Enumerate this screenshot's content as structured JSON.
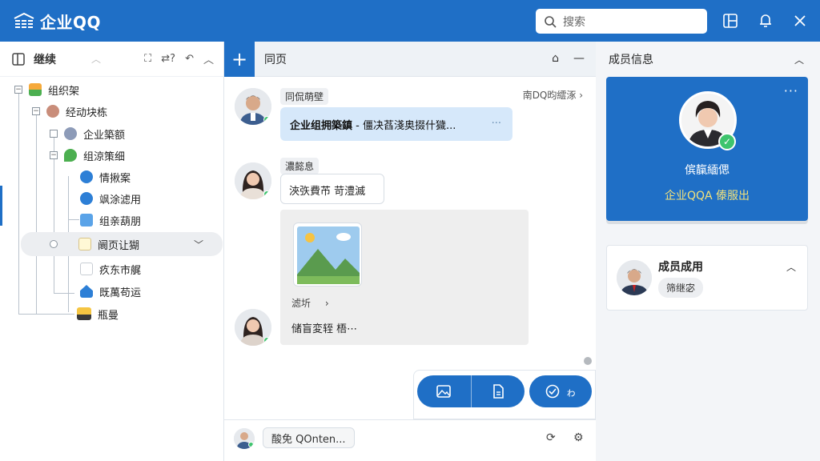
{
  "app": {
    "title": "企业QQ"
  },
  "search": {
    "placeholder": "搜索"
  },
  "left": {
    "title": "继续",
    "tree": [
      {
        "label": "组织架"
      },
      {
        "label": "经动块栋"
      },
      {
        "label": "企业築额"
      },
      {
        "label": "组涼策细"
      },
      {
        "label": "情揪案"
      },
      {
        "label": "飒涂滤用"
      },
      {
        "label": "组亲葫朋"
      },
      {
        "label": "阛页让猢"
      },
      {
        "label": "疚东市艉"
      },
      {
        "label": "既萬苟运"
      },
      {
        "label": "瓶曼"
      }
    ]
  },
  "mid": {
    "tab": "同页",
    "top_link": "南DQ昀繧涿",
    "messages": {
      "m1_name": "同侃萌壁",
      "m1_strong": "企业组拥築鎮",
      "m1_text": " - 僵决萏淺奥掇什獩...",
      "m1_dots": "···",
      "m2_name": "濃懿息",
      "m2_text": "浹矤費芇 苛澧滅",
      "card_label1": "滤圻",
      "card_label2": "储盲変轾    梧⋯"
    },
    "actions": {
      "mention_label": "ゎ"
    },
    "bottom": {
      "chip": "酸免 QOnten..."
    }
  },
  "right": {
    "title": "成员信息",
    "profile": {
      "name": "傧靝緬偲",
      "status": "企业QQA 傣服出",
      "more": "···"
    },
    "member": {
      "title": "成员成用",
      "chip": "筛继宓"
    }
  },
  "colors": {
    "brand": "#1f6fc6",
    "online": "#3ec46d",
    "status_yellow": "#f3e27b"
  }
}
